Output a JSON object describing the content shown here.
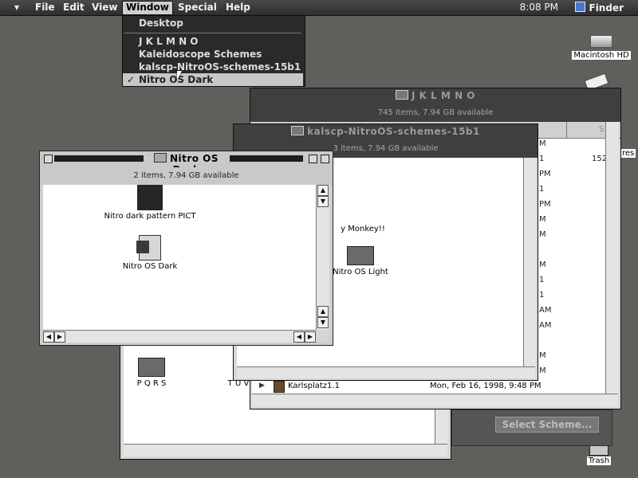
{
  "menubar": {
    "apple": "▾",
    "items": [
      "File",
      "Edit",
      "View",
      "Window",
      "Special",
      "Help"
    ],
    "clock": "8:08 PM",
    "finder": "Finder"
  },
  "window_menu": {
    "items": [
      "Desktop",
      "J K L M N O",
      "Kaleidoscope Schemes",
      "kalscp-NitroOS-schemes-15b1",
      "Nitro OS Dark"
    ],
    "checkmark": "✓"
  },
  "desktop": {
    "macintosh_hd": "Macintosh HD",
    "trash": "Trash",
    "partial_right_label": "res"
  },
  "window_jklmno": {
    "title": "J K L M N O",
    "info": "745 items, 7.94 GB available",
    "col_header_s": "S",
    "rows": [
      {
        "time": "M"
      },
      {
        "time": "1"
      },
      {
        "time": "PM"
      },
      {
        "time": "1"
      },
      {
        "time": "PM"
      },
      {
        "time": "M"
      },
      {
        "time": "M"
      },
      {
        "time": "M"
      },
      {
        "time": "1"
      },
      {
        "time": "1"
      },
      {
        "time": "AM"
      },
      {
        "time": "AM"
      },
      {
        "time": "M"
      },
      {
        "time": "M"
      }
    ],
    "partial_value": "152",
    "list_item": {
      "name": "Karlsplatz1.1",
      "date": "Mon, Feb 16, 1998, 9:48 PM"
    },
    "button": "Select Scheme..."
  },
  "window_kalscp": {
    "title": "kalscp-NitroOS-schemes-15b1",
    "info": "3 items, 7.94 GB available",
    "items": [
      "y Monkey!!",
      "Nitro OS Light"
    ]
  },
  "window_kaleidoscope": {
    "items": [
      "P Q R S",
      "T U V"
    ]
  },
  "window_front": {
    "title": "Nitro OS Dark",
    "info": "2 items, 7.94 GB available",
    "items": [
      "Nitro dark pattern PICT",
      "Nitro OS Dark"
    ]
  }
}
